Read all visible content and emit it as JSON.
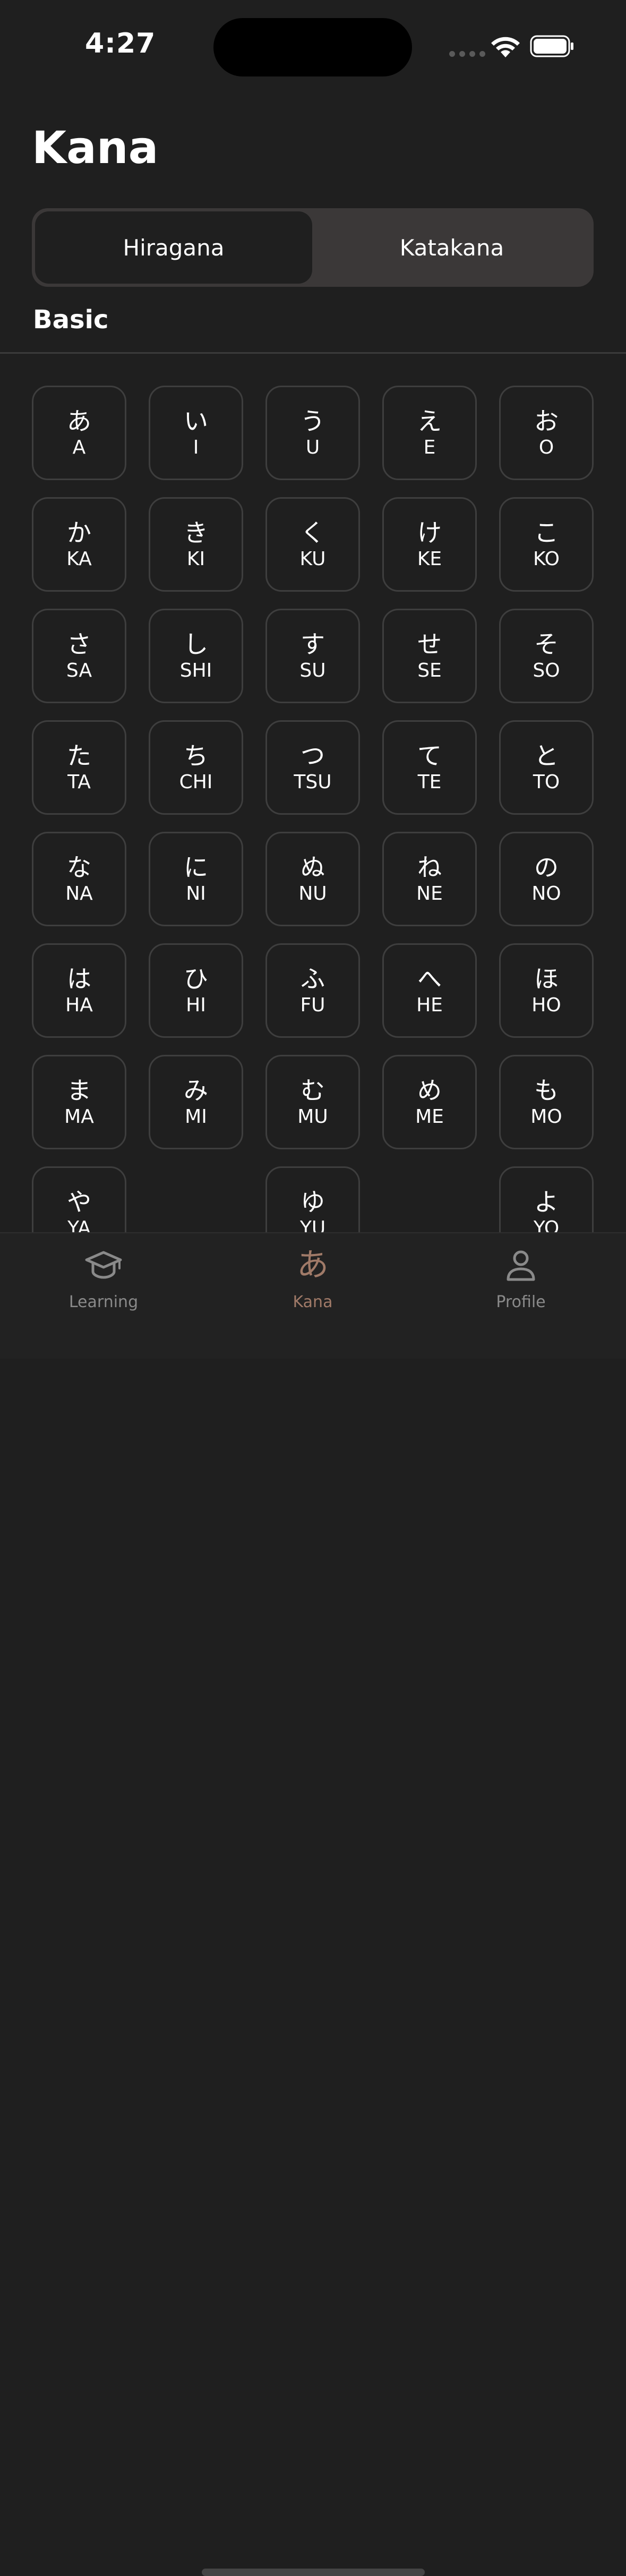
{
  "status_bar": {
    "time": "4:27"
  },
  "header": {
    "title": "Kana"
  },
  "segmented": {
    "options": [
      "Hiragana",
      "Katakana"
    ],
    "selected": "Hiragana"
  },
  "section": {
    "title": "Basic"
  },
  "kana_grid": [
    {
      "kana": "あ",
      "romaji": "A"
    },
    {
      "kana": "い",
      "romaji": "I"
    },
    {
      "kana": "う",
      "romaji": "U"
    },
    {
      "kana": "え",
      "romaji": "E"
    },
    {
      "kana": "お",
      "romaji": "O"
    },
    {
      "kana": "か",
      "romaji": "KA"
    },
    {
      "kana": "き",
      "romaji": "KI"
    },
    {
      "kana": "く",
      "romaji": "KU"
    },
    {
      "kana": "け",
      "romaji": "KE"
    },
    {
      "kana": "こ",
      "romaji": "KO"
    },
    {
      "kana": "さ",
      "romaji": "SA"
    },
    {
      "kana": "し",
      "romaji": "SHI"
    },
    {
      "kana": "す",
      "romaji": "SU"
    },
    {
      "kana": "せ",
      "romaji": "SE"
    },
    {
      "kana": "そ",
      "romaji": "SO"
    },
    {
      "kana": "た",
      "romaji": "TA"
    },
    {
      "kana": "ち",
      "romaji": "CHI"
    },
    {
      "kana": "つ",
      "romaji": "TSU"
    },
    {
      "kana": "て",
      "romaji": "TE"
    },
    {
      "kana": "と",
      "romaji": "TO"
    },
    {
      "kana": "な",
      "romaji": "NA"
    },
    {
      "kana": "に",
      "romaji": "NI"
    },
    {
      "kana": "ぬ",
      "romaji": "NU"
    },
    {
      "kana": "ね",
      "romaji": "NE"
    },
    {
      "kana": "の",
      "romaji": "NO"
    },
    {
      "kana": "は",
      "romaji": "HA"
    },
    {
      "kana": "ひ",
      "romaji": "HI"
    },
    {
      "kana": "ふ",
      "romaji": "FU"
    },
    {
      "kana": "へ",
      "romaji": "HE"
    },
    {
      "kana": "ほ",
      "romaji": "HO"
    },
    {
      "kana": "ま",
      "romaji": "MA"
    },
    {
      "kana": "み",
      "romaji": "MI"
    },
    {
      "kana": "む",
      "romaji": "MU"
    },
    {
      "kana": "め",
      "romaji": "ME"
    },
    {
      "kana": "も",
      "romaji": "MO"
    },
    {
      "kana": "や",
      "romaji": "YA"
    },
    null,
    {
      "kana": "ゆ",
      "romaji": "YU"
    },
    null,
    {
      "kana": "よ",
      "romaji": "YO"
    }
  ],
  "tab_bar": {
    "tabs": [
      {
        "label": "Learning",
        "icon": "graduation-cap-icon",
        "active": false
      },
      {
        "label": "Kana",
        "icon": "hiragana-a-icon",
        "glyph": "あ",
        "active": true
      },
      {
        "label": "Profile",
        "icon": "person-icon",
        "active": false
      }
    ]
  },
  "colors": {
    "background": "#1f1f1f",
    "accent": "#a07a68",
    "inactive": "#8a8a8a"
  }
}
